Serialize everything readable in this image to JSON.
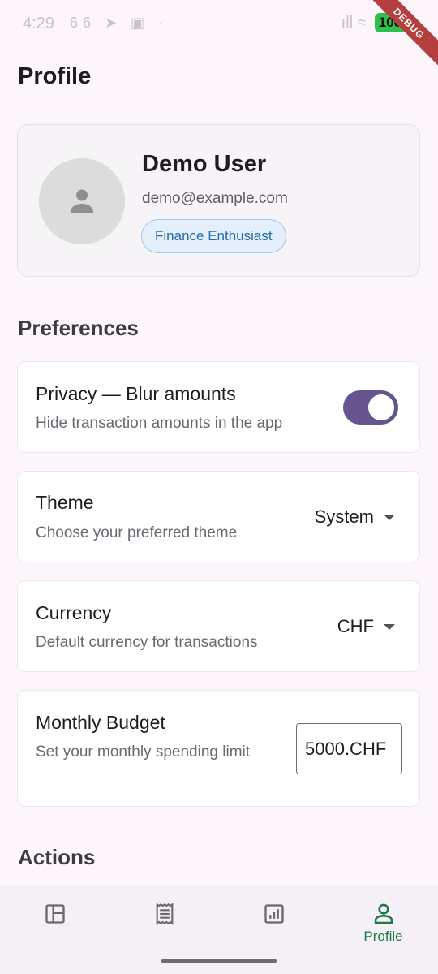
{
  "status_bar": {
    "time": "4:29",
    "left_icons": "66 ➤ ▣ ·",
    "right_icons": "ıll ≈",
    "battery": "100"
  },
  "debug_banner": "DEBUG",
  "page": {
    "title": "Profile"
  },
  "profile": {
    "name": "Demo User",
    "email": "demo@example.com",
    "badge": "Finance Enthusiast",
    "avatar_icon": "person-icon"
  },
  "preferences": {
    "section_title": "Preferences",
    "privacy": {
      "title": "Privacy — Blur amounts",
      "subtitle": "Hide transaction amounts in the app",
      "enabled": true
    },
    "theme": {
      "title": "Theme",
      "subtitle": "Choose your preferred theme",
      "selected": "System"
    },
    "currency": {
      "title": "Currency",
      "subtitle": "Default currency for transactions",
      "selected": "CHF"
    },
    "budget": {
      "title": "Monthly Budget",
      "subtitle": "Set your monthly spending limit",
      "value": "5000.CHF"
    }
  },
  "actions": {
    "section_title": "Actions"
  },
  "bottom_nav": {
    "items": [
      {
        "icon": "dashboard-icon",
        "label": ""
      },
      {
        "icon": "receipt-icon",
        "label": ""
      },
      {
        "icon": "chart-icon",
        "label": ""
      },
      {
        "icon": "profile-icon",
        "label": "Profile",
        "active": true
      }
    ]
  },
  "colors": {
    "accent": "#65558f",
    "nav_active": "#1c7a47",
    "badge_text": "#2a6aa8",
    "background": "#fdf5fc"
  }
}
